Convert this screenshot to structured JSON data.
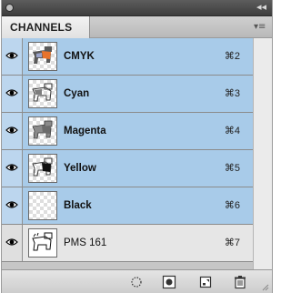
{
  "panel": {
    "tab_label": "CHANNELS",
    "collapse_glyph": "◂◂",
    "menu_glyph": "▾≡"
  },
  "channels": [
    {
      "name": "CMYK",
      "shortcut": "⌘2",
      "selected": true,
      "visible": true
    },
    {
      "name": "Cyan",
      "shortcut": "⌘3",
      "selected": true,
      "visible": true
    },
    {
      "name": "Magenta",
      "shortcut": "⌘4",
      "selected": true,
      "visible": true
    },
    {
      "name": "Yellow",
      "shortcut": "⌘5",
      "selected": true,
      "visible": true
    },
    {
      "name": "Black",
      "shortcut": "⌘6",
      "selected": true,
      "visible": true
    },
    {
      "name": "PMS 161",
      "shortcut": "⌘7",
      "selected": false,
      "visible": true
    }
  ],
  "footer_buttons": [
    "load-channel-as-selection-icon",
    "save-selection-as-channel-icon",
    "new-channel-icon",
    "trash-icon"
  ],
  "colors": {
    "selected_row": "#a8cbe9",
    "unselected_row": "#e6e6e6",
    "panel_bg": "#d6d6d6",
    "titlebar": "#4a4a4a"
  }
}
